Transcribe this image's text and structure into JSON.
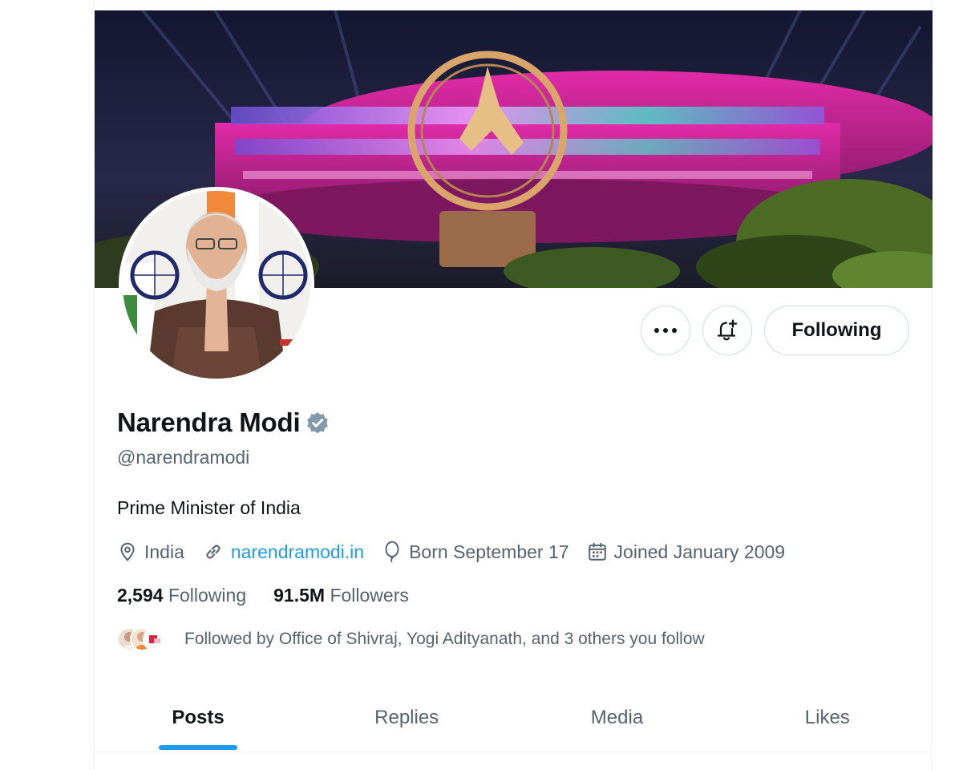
{
  "profile": {
    "display_name": "Narendra Modi",
    "verified": true,
    "handle": "@narendramodi",
    "bio": "Prime Minister of India",
    "location": "India",
    "website": "narendramodi.in",
    "birthday": "Born September 17",
    "joined": "Joined January 2009"
  },
  "stats": {
    "following_count": "2,594",
    "following_label": "Following",
    "followers_count": "91.5M",
    "followers_label": "Followers"
  },
  "followed_by": {
    "text": "Followed by Office of Shivraj, Yogi Adityanath, and 3 others you follow"
  },
  "actions": {
    "more_icon": "more-horizontal-icon",
    "notify_icon": "bell-plus-icon",
    "following_button_label": "Following"
  },
  "tabs": [
    {
      "label": "Posts",
      "active": true
    },
    {
      "label": "Replies",
      "active": false
    },
    {
      "label": "Media",
      "active": false
    },
    {
      "label": "Likes",
      "active": false
    }
  ],
  "colors": {
    "accent": "#1d9bf0",
    "verified_badge": "#829aab",
    "secondary_text": "#536471",
    "primary_text": "#0f1419",
    "banner_building": "#d0279a"
  },
  "icons": {
    "location": "location-pin-icon",
    "website": "link-icon",
    "birthday": "balloon-icon",
    "joined": "calendar-icon",
    "verified": "verified-badge-icon"
  }
}
